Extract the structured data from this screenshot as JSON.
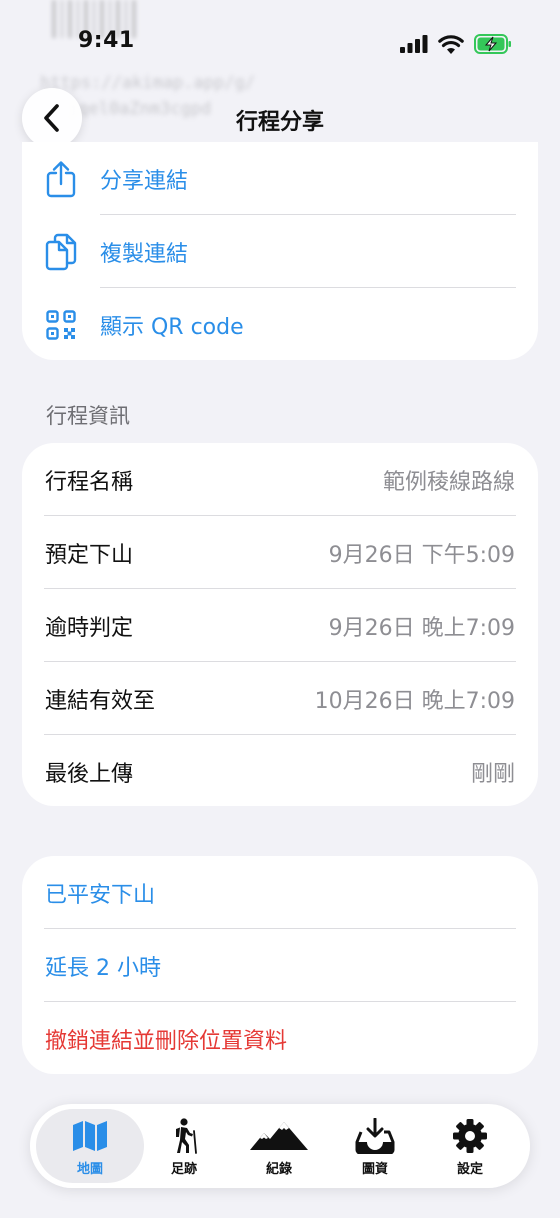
{
  "status_bar": {
    "time": "9:41"
  },
  "background_url": {
    "line1": "https://akimap.app/g/",
    "line2": "jqel0aZnm3cgpd"
  },
  "nav": {
    "title": "行程分享"
  },
  "share_actions": [
    {
      "label": "分享連結",
      "icon": "share-icon"
    },
    {
      "label": "複製連結",
      "icon": "copy-icon"
    },
    {
      "label": "顯示 QR code",
      "icon": "qr-code-icon"
    }
  ],
  "info_section": {
    "header": "行程資訊",
    "rows": [
      {
        "key": "行程名稱",
        "value": "範例稜線路線"
      },
      {
        "key": "預定下山",
        "value": "9月26日 下午5:09"
      },
      {
        "key": "逾時判定",
        "value": "9月26日 晚上7:09"
      },
      {
        "key": "連結有效至",
        "value": "10月26日 晚上7:09"
      },
      {
        "key": "最後上傳",
        "value": "剛剛"
      }
    ]
  },
  "actions": [
    {
      "label": "已平安下山",
      "color": "#2a8ee8"
    },
    {
      "label": "延長 2 小時",
      "color": "#2a8ee8"
    },
    {
      "label": "撤銷連結並刪除位置資料",
      "color": "#e53935"
    }
  ],
  "tabbar": {
    "selected": "地圖",
    "tabs": [
      {
        "label": "地圖",
        "icon": "map-icon"
      },
      {
        "label": "足跡",
        "icon": "hiker-icon"
      },
      {
        "label": "紀錄",
        "icon": "mountains-icon"
      },
      {
        "label": "圖資",
        "icon": "download-tray-icon"
      },
      {
        "label": "設定",
        "icon": "gear-icon"
      }
    ]
  },
  "colors": {
    "accent": "#2a8ee8",
    "destructive": "#e53935",
    "battery": "#34c759"
  }
}
